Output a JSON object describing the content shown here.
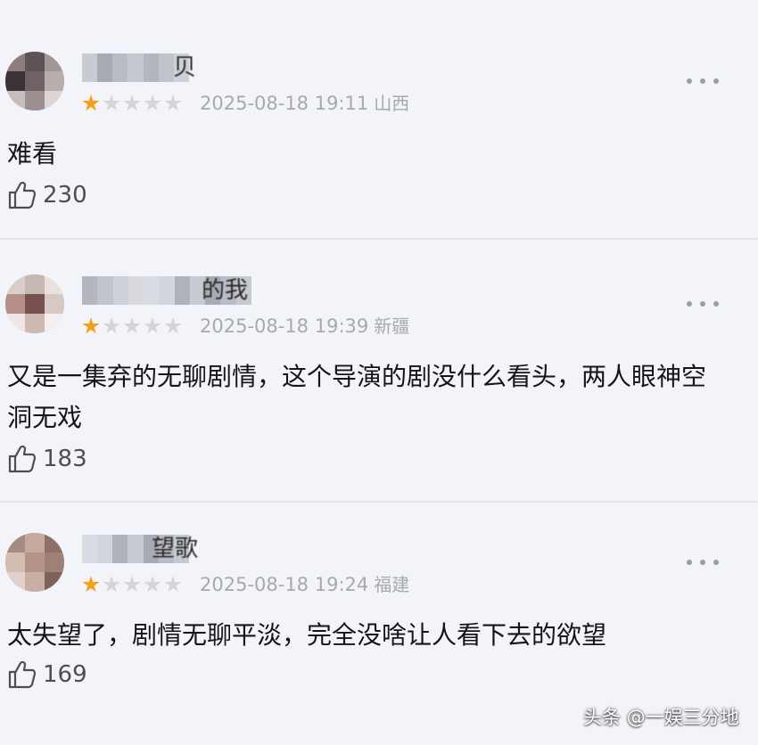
{
  "comments": [
    {
      "name_visible_suffix": "贝",
      "rating_filled": 1,
      "rating_total": 5,
      "timestamp": "2025-08-18 19:11",
      "location": "山西",
      "text": "难看",
      "likes": "230",
      "avatar_colors": [
        "#8d7d7c",
        "#5d5355",
        "#a39696",
        "#3a3236",
        "#6e6264",
        "#b8aeae",
        "#c7bdbd",
        "#9c8f90",
        "#dcd5d5"
      ]
    },
    {
      "name_visible_suffix": "的我",
      "rating_filled": 1,
      "rating_total": 5,
      "timestamp": "2025-08-18 19:39",
      "location": "新疆",
      "text": "又是一集弃的无聊剧情，这个导演的剧没什么看头，两人眼神空洞无戏",
      "likes": "183",
      "avatar_colors": [
        "#d8cdc8",
        "#c5b8b3",
        "#e9e1df",
        "#b58f8a",
        "#7a4f4f",
        "#d6c9c4",
        "#efe7e6",
        "#cdb9b2",
        "#f4efee"
      ]
    },
    {
      "name_visible_suffix": "望歌",
      "rating_filled": 1,
      "rating_total": 5,
      "timestamp": "2025-08-18 19:24",
      "location": "福建",
      "text": "太失望了，剧情无聊平淡，完全没啥让人看下去的欲望",
      "likes": "169",
      "avatar_colors": [
        "#a58b82",
        "#c6a89c",
        "#8d7167",
        "#d4bcb1",
        "#b59388",
        "#9e8076",
        "#e2d1ca",
        "#c9aea4",
        "#7c6259"
      ]
    }
  ],
  "watermark": "头条 @一娱三分地",
  "icons": {
    "like": "thumbs-up-icon",
    "more": "more-dots-icon",
    "star": "star-icon"
  },
  "colors": {
    "background": "#f3f4f9",
    "star_filled": "#f3a11a",
    "star_empty": "#d4d5dc",
    "meta_text": "#a7a9b1"
  }
}
